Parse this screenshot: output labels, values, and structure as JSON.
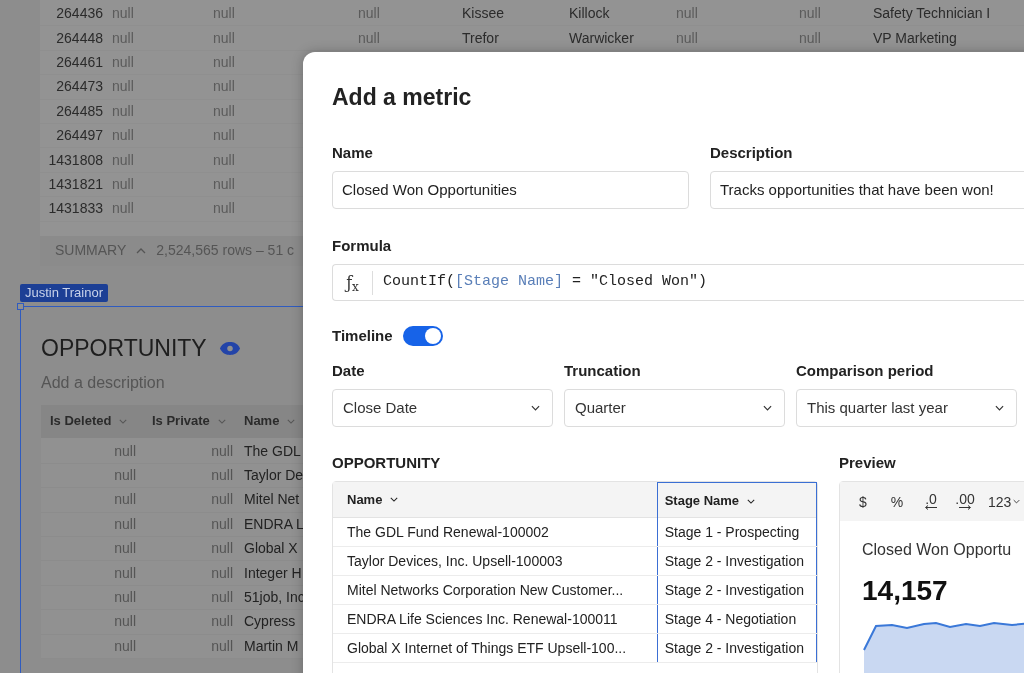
{
  "background_table": {
    "rows": [
      {
        "cells": [
          "264436",
          "null",
          "null",
          "null",
          "Kissee",
          "Killock",
          "null",
          "null",
          "Safety Technician I"
        ]
      },
      {
        "cells": [
          "264448",
          "null",
          "null",
          "null",
          "Trefor",
          "Warwicker",
          "null",
          "null",
          "VP Marketing"
        ]
      },
      {
        "cells": [
          "264461",
          "null",
          "null"
        ]
      },
      {
        "cells": [
          "264473",
          "null",
          "null"
        ]
      },
      {
        "cells": [
          "264485",
          "null",
          "null"
        ]
      },
      {
        "cells": [
          "264497",
          "null",
          "null"
        ]
      },
      {
        "cells": [
          "1431808",
          "null",
          "null"
        ]
      },
      {
        "cells": [
          "1431821",
          "null",
          "null"
        ]
      },
      {
        "cells": [
          "1431833",
          "null",
          "null"
        ]
      }
    ],
    "summary": {
      "label": "SUMMARY",
      "text": "2,524,565 rows – 51 c"
    }
  },
  "user_tag": "Justin Trainor",
  "element": {
    "title": "OPPORTUNITY",
    "description_placeholder": "Add a description",
    "columns": [
      "Is Deleted",
      "Is Private",
      "Name"
    ],
    "rows": [
      [
        "null",
        "null",
        "The GDL"
      ],
      [
        "null",
        "null",
        "Taylor De"
      ],
      [
        "null",
        "null",
        "Mitel Net"
      ],
      [
        "null",
        "null",
        "ENDRA L"
      ],
      [
        "null",
        "null",
        "Global X"
      ],
      [
        "null",
        "null",
        "Integer H"
      ],
      [
        "null",
        "null",
        "51job, Inc"
      ],
      [
        "null",
        "null",
        "Cypress"
      ],
      [
        "null",
        "null",
        "Martin M"
      ]
    ]
  },
  "modal": {
    "title": "Add a metric",
    "name": {
      "label": "Name",
      "value": "Closed Won Opportunities"
    },
    "description": {
      "label": "Description",
      "value": "Tracks opportunities that have been won!"
    },
    "formula": {
      "label": "Formula",
      "fx": "ƒ$_{x}$",
      "segments": [
        {
          "kind": "plain",
          "text": "CountIf("
        },
        {
          "kind": "column_ref",
          "text": "[Stage Name]"
        },
        {
          "kind": "plain",
          "text": " = \"Closed Won\")"
        }
      ]
    },
    "timeline": {
      "label": "Timeline",
      "on": true
    },
    "selects": [
      {
        "label": "Date",
        "value": "Close Date"
      },
      {
        "label": "Truncation",
        "value": "Quarter"
      },
      {
        "label": "Comparison period",
        "value": "This quarter last year"
      }
    ],
    "table": {
      "title": "OPPORTUNITY",
      "columns": [
        {
          "label": "Name",
          "selected": false
        },
        {
          "label": "Stage Name",
          "selected": true
        }
      ],
      "rows": [
        [
          "The GDL Fund Renewal-100002",
          "Stage 1 - Prospecting"
        ],
        [
          "Taylor Devices, Inc. Upsell-100003",
          "Stage 2 - Investigation"
        ],
        [
          "Mitel Networks Corporation New Customer...",
          "Stage 2 - Investigation"
        ],
        [
          "ENDRA Life Sciences Inc. Renewal-100011",
          "Stage 4 - Negotiation"
        ],
        [
          "Global X Internet of Things ETF Upsell-100...",
          "Stage 2 - Investigation"
        ]
      ]
    },
    "preview": {
      "label": "Preview",
      "format_buttons": [
        {
          "kind": "currency",
          "text": "$"
        },
        {
          "kind": "percent",
          "text": "%"
        },
        {
          "kind": "decrease_decimals",
          "text": ".0"
        },
        {
          "kind": "increase_decimals",
          "text": ".00"
        },
        {
          "kind": "number_format",
          "text": "123"
        }
      ],
      "card_title": "Closed Won Opportu",
      "value": "14,157"
    }
  }
}
